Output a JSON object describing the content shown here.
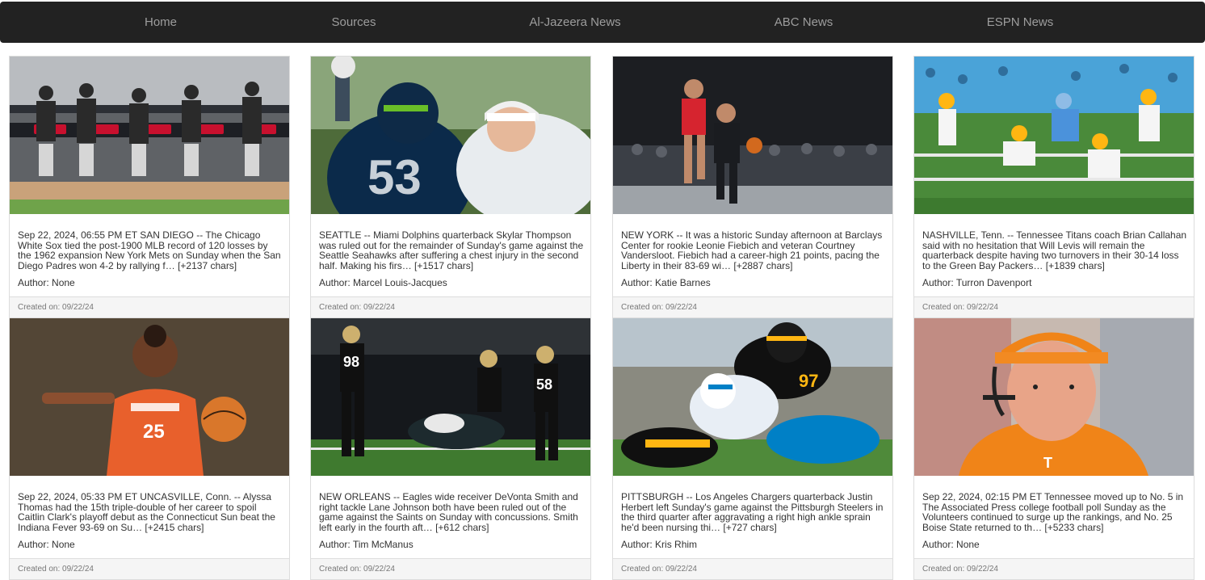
{
  "nav": {
    "items": [
      {
        "label": "Home"
      },
      {
        "label": "Sources"
      },
      {
        "label": "Al-Jazeera News"
      },
      {
        "label": "ABC News"
      },
      {
        "label": "ESPN News"
      }
    ]
  },
  "labels": {
    "author_prefix": "Author: ",
    "created_prefix": "Created on: "
  },
  "articles": [
    {
      "image_desc": "baseball dugout",
      "description": "Sep 22, 2024, 06:55 PM ET SAN DIEGO -- The Chicago White Sox tied the post-1900 MLB record of 120 losses by the 1962 expansion New York Mets on Sunday when the San Diego Padres won 4-2 by rallying f… [+2137 chars]",
      "author": "None",
      "created": "09/22/24"
    },
    {
      "image_desc": "football seahawks dolphins",
      "description": "SEATTLE -- Miami Dolphins quarterback Skylar Thompson was ruled out for the remainder of Sunday's game against the Seattle Seahawks after suffering a chest injury in the second half. Making his firs… [+1517 chars]",
      "author": "Marcel Louis-Jacques",
      "created": "09/22/24"
    },
    {
      "image_desc": "basketball liberty",
      "description": "NEW YORK -- It was a historic Sunday afternoon at Barclays Center for rookie Leonie Fiebich and veteran Courtney Vandersloot. Fiebich had a career-high 21 points, pacing the Liberty in their 83-69 wi… [+2887 chars]",
      "author": "Katie Barnes",
      "created": "09/22/24"
    },
    {
      "image_desc": "football titans packers",
      "description": "NASHVILLE, Tenn. -- Tennessee Titans coach Brian Callahan said with no hesitation that Will Levis will remain the quarterback despite having two turnovers in their 30-14 loss to the Green Bay Packers… [+1839 chars]",
      "author": "Turron Davenport",
      "created": "09/22/24"
    },
    {
      "image_desc": "basketball connecticut sun",
      "description": "Sep 22, 2024, 05:33 PM ET UNCASVILLE, Conn. -- Alyssa Thomas had the 15th triple-double of her career to spoil Caitlin Clark's playoff debut as the Connecticut Sun beat the Indiana Fever 93-69 on Su… [+2415 chars]",
      "author": "None",
      "created": "09/22/24"
    },
    {
      "image_desc": "football saints eagles",
      "description": "NEW ORLEANS -- Eagles wide receiver DeVonta Smith and right tackle Lane Johnson both have been ruled out of the game against the Saints on Sunday with concussions. Smith left early in the fourth aft… [+612 chars]",
      "author": "Tim McManus",
      "created": "09/22/24"
    },
    {
      "image_desc": "football steelers chargers",
      "description": "PITTSBURGH -- Los Angeles Chargers quarterback Justin Herbert left Sunday's game against the Pittsburgh Steelers in the third quarter after aggravating a right high ankle sprain he'd been nursing thi… [+727 chars]",
      "author": "Kris Rhim",
      "created": "09/22/24"
    },
    {
      "image_desc": "tennessee coach headset",
      "description": "Sep 22, 2024, 02:15 PM ET Tennessee moved up to No. 5 in The Associated Press college football poll Sunday as the Volunteers continued to surge up the rankings, and No. 25 Boise State returned to th… [+5233 chars]",
      "author": "None",
      "created": "09/22/24"
    }
  ]
}
